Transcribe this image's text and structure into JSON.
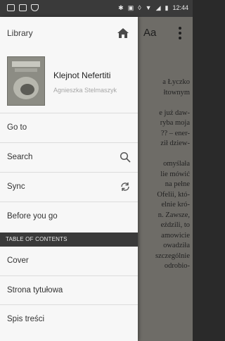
{
  "status_bar": {
    "time": "12:44",
    "signal_text": "4"
  },
  "drawer": {
    "title": "Library",
    "book": {
      "title": "Klejnot Nefertiti",
      "author": "Agnieszka Stelmaszyk"
    },
    "menu": [
      {
        "label": "Go to",
        "icon": ""
      },
      {
        "label": "Search",
        "icon": "search-icon"
      },
      {
        "label": "Sync",
        "icon": "sync-icon"
      },
      {
        "label": "Before you go",
        "icon": ""
      }
    ],
    "toc_header": "TABLE OF CONTENTS",
    "toc": [
      {
        "label": "Cover"
      },
      {
        "label": "Strona tytułowa"
      },
      {
        "label": "Spis treści"
      }
    ]
  },
  "reader": {
    "font_button": "Aa",
    "text_lines": [
      "a Łyczko",
      "łtownym",
      "",
      "e już daw-",
      "ryba moja",
      "?? – ener-",
      "ził dziew-",
      "",
      "omyślała",
      "lie mówić",
      "na pełne",
      "Ofelii, któ-",
      "elnie kró-",
      "n. Zawsze,",
      "eździli, to",
      "amowicie",
      "owadziła",
      "szczególnie",
      "odrobio-"
    ]
  },
  "colors": {
    "drawer_bg": "#f7f7f7",
    "toc_header_bg": "#3a3a3a",
    "page_bg": "#6e6c67",
    "status_bar_bg": "#3a3a3a"
  }
}
